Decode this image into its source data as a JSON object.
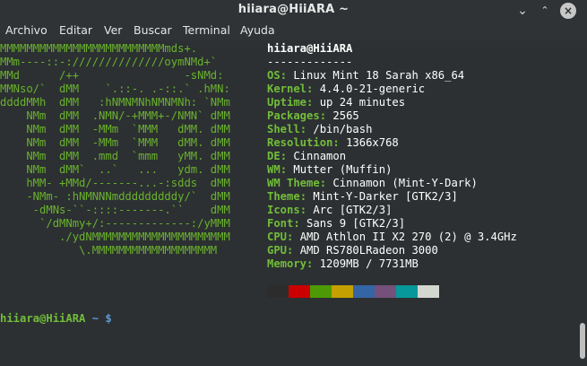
{
  "window": {
    "title": "hiiara@HiiARA ~",
    "minimize_glyph": "⌄",
    "maximize_glyph": "⌃",
    "close_glyph": "×"
  },
  "menu": [
    "Archivo",
    "Editar",
    "Ver",
    "Buscar",
    "Terminal",
    "Ayuda"
  ],
  "logo_lines": [
    "MMMMMMMMMMMMMMMMMMMMMMMMMmds+.",
    "MMm----::-://////////////oymNMd+`",
    "MMd      /++                -sNMd:",
    "MMNso/`  dMM    `.::-. .-::.` .hMN:",
    "ddddMMh  dMM   :hNMNMNhNMNMNh: `NMm",
    "    NMm  dMM  .NMN/-+MMM+-/NMN` dMM",
    "    NMm  dMM  -MMm  `MMM   dMM. dMM",
    "    NMm  dMM  -MMm  `MMM   dMM. dMM",
    "    NMm  dMM  .mmd  `mmm   yMM. dMM",
    "    NMm  dMM`  ..`   ...   ydm. dMM",
    "    hMM- +MMd/-------...-:sdds  dMM",
    "    -NMm- :hNMNNNmdddddddddy/`  dMM",
    "     -dMNs-``-::::-------.``    dMM",
    "      `/dMNmy+/:-------------:/yMMM",
    "         ./ydNMMMMMMMMMMMMMMMMMMMMM",
    "            \\.MMMMMMMMMMMMMMMMMMM"
  ],
  "info": {
    "header": "hiiara@HiiARA",
    "separator": "-------------",
    "rows": [
      {
        "key": "OS",
        "value": "Linux Mint 18 Sarah x86_64"
      },
      {
        "key": "Kernel",
        "value": "4.4.0-21-generic"
      },
      {
        "key": "Uptime",
        "value": "up 24 minutes"
      },
      {
        "key": "Packages",
        "value": "2565"
      },
      {
        "key": "Shell",
        "value": "/bin/bash"
      },
      {
        "key": "Resolution",
        "value": "1366x768"
      },
      {
        "key": "DE",
        "value": "Cinnamon"
      },
      {
        "key": "WM",
        "value": "Mutter (Muffin)"
      },
      {
        "key": "WM Theme",
        "value": "Cinnamon (Mint-Y-Dark)"
      },
      {
        "key": "Theme",
        "value": "Mint-Y-Darker [GTK2/3]"
      },
      {
        "key": "Icons",
        "value": "Arc [GTK2/3]"
      },
      {
        "key": "Font",
        "value": "Sans 9 [GTK2/3]"
      },
      {
        "key": "CPU",
        "value": "AMD Athlon II X2 270 (2) @ 3.4GHz"
      },
      {
        "key": "GPU",
        "value": "AMD RS780LRadeon 3000"
      },
      {
        "key": "Memory",
        "value": "1209MB / 7731MB"
      }
    ]
  },
  "palette": [
    "#2c2c2c",
    "#cc0000",
    "#4e9a06",
    "#c4a000",
    "#3465a4",
    "#75507b",
    "#06989a",
    "#d3d7cf"
  ],
  "prompt": {
    "user_host": "hiiara@HiiARA",
    "path_symbol": " ~ $"
  },
  "colors": {
    "logo_green": "#6ab22d",
    "key_green": "#72bd3a",
    "prompt_blue": "#5e9bd6",
    "background": "#2c3032"
  }
}
